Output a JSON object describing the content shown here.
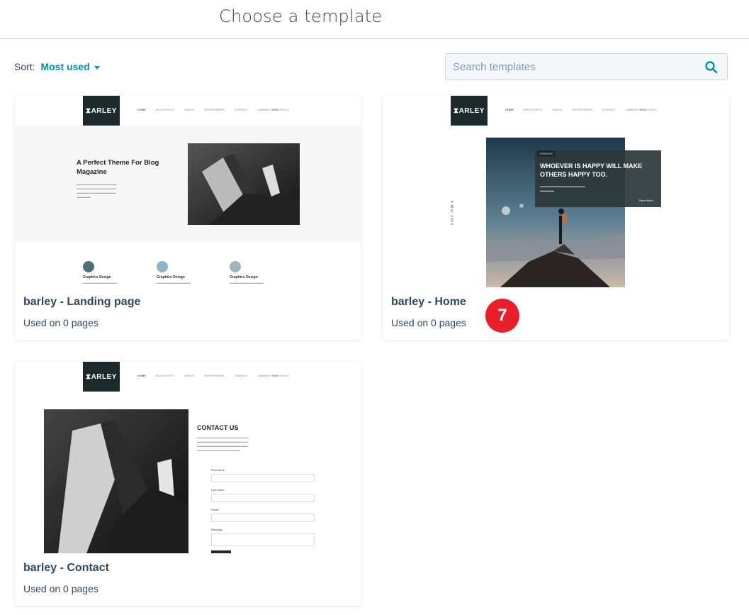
{
  "header": {
    "title": "Choose a template"
  },
  "sort": {
    "label": "Sort:",
    "value": "Most used"
  },
  "search": {
    "placeholder": "Search templates"
  },
  "badge": {
    "number": "7"
  },
  "preview_nav": {
    "logo": "ARLEY",
    "items": [
      "HOME",
      "BLOG POSTS",
      "SINGLE",
      "ENTERPRISES",
      "CONTACT",
      "LANDING PAGE"
    ],
    "lang": "ENGLISH"
  },
  "cards": [
    {
      "title": "barley - Landing page",
      "meta": "Used on 0 pages",
      "preview": {
        "hero_title": "A Perfect Theme For Blog Magazine",
        "features": [
          "Graphics Design",
          "Graphics Design",
          "Graphics Design"
        ]
      }
    },
    {
      "title": "barley - Home",
      "meta": "Used on 0 pages",
      "preview": {
        "tag": "FASHION",
        "quote": "WHOEVER IS HAPPY WILL MAKE OTHERS HAPPY TOO.",
        "date": "4 Mar 2020",
        "read_more": "Read More"
      }
    },
    {
      "title": "barley - Contact",
      "meta": "Used on 0 pages",
      "preview": {
        "heading": "CONTACT US",
        "fields": [
          "First name",
          "Last name",
          "Email*",
          "Message"
        ]
      }
    }
  ]
}
